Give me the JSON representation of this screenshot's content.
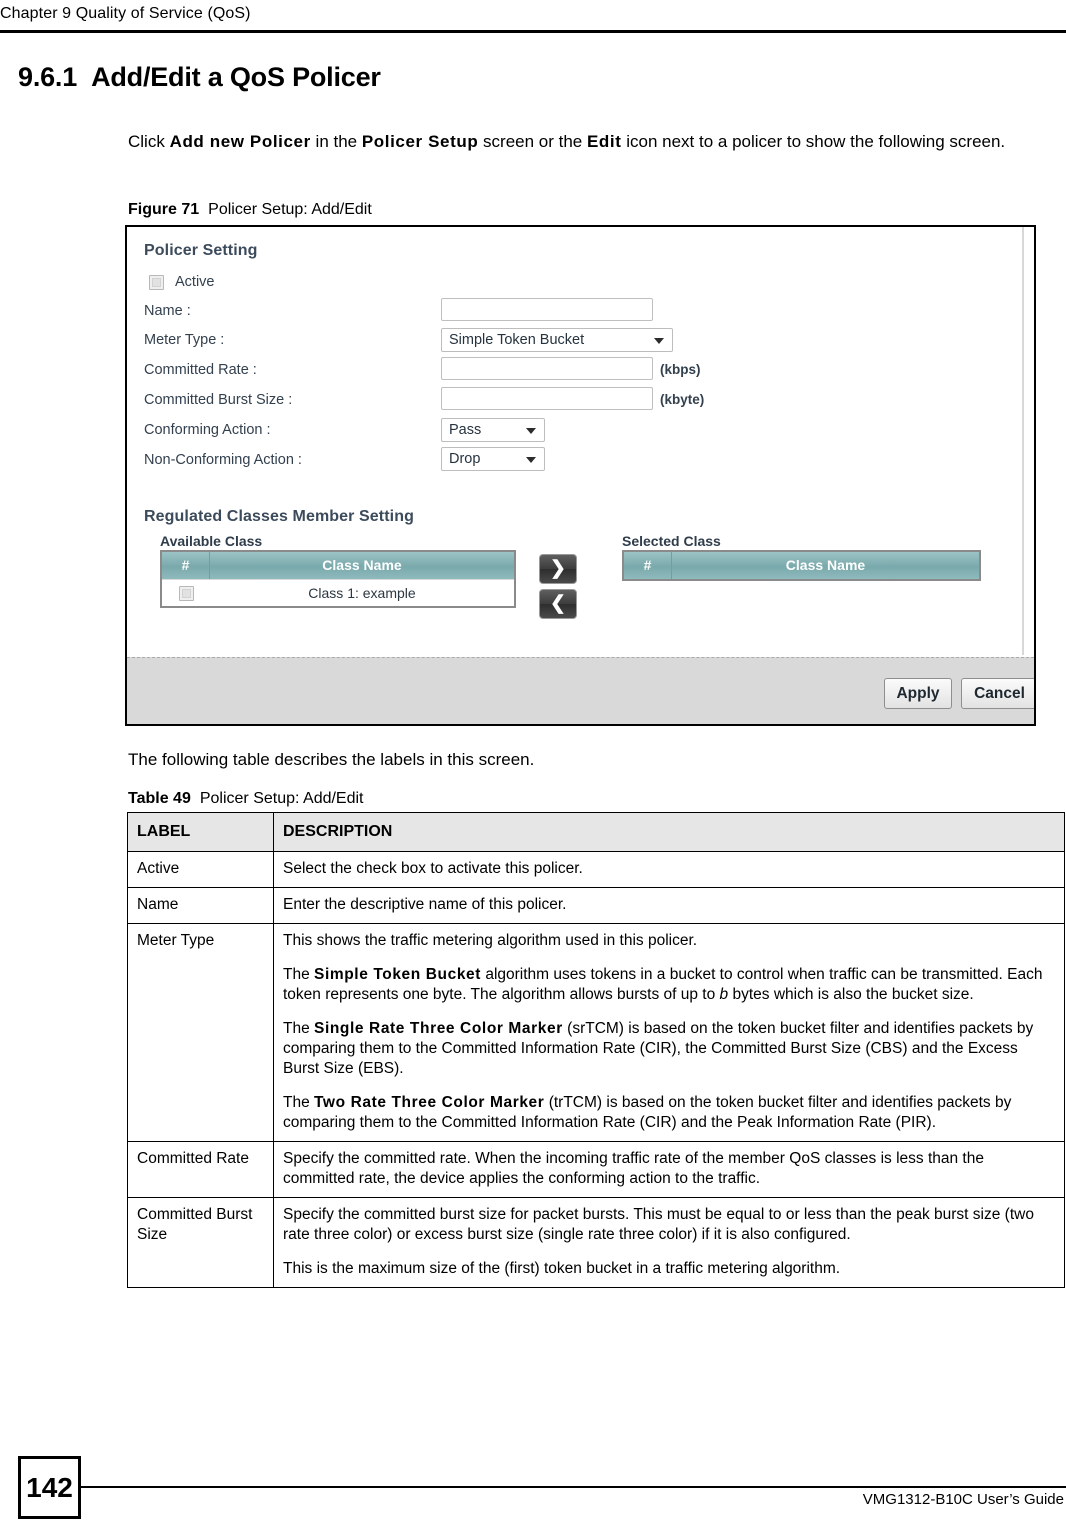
{
  "header": {
    "running_head": "Chapter 9 Quality of Service (QoS)"
  },
  "section": {
    "number": "9.6.1",
    "title": "Add/Edit a QoS Policer"
  },
  "intro": {
    "t1": "Click ",
    "b1": "Add new  Policer",
    "t2": " in the ",
    "b2": "Policer Setup",
    "t3": " screen or the ",
    "b3": "Edit",
    "t4": " icon next to a policer to show the following screen."
  },
  "figure": {
    "label": "Figure 71",
    "caption": "Policer Setup: Add/Edit"
  },
  "screen": {
    "policer_setting_title": "Policer Setting",
    "active_label": "Active",
    "name_label": "Name :",
    "meter_type_label": "Meter Type :",
    "meter_type_value": "Simple Token Bucket",
    "committed_rate_label": "Committed Rate :",
    "committed_rate_unit": "(kbps)",
    "committed_burst_label": "Committed Burst Size :",
    "committed_burst_unit": "(kbyte)",
    "conforming_label": "Conforming Action :",
    "conforming_value": "Pass",
    "nonconforming_label": "Non-Conforming Action :",
    "nonconforming_value": "Drop",
    "name_value": "",
    "committed_rate_value": "",
    "committed_burst_value": "",
    "regulated_title": "Regulated Classes Member Setting",
    "available_class_title": "Available Class",
    "selected_class_title": "Selected Class",
    "col_hash": "#",
    "col_class_name": "Class Name",
    "available_rows": [
      {
        "name": "Class 1: example"
      }
    ],
    "selected_rows": [],
    "move_right_icon": "❯",
    "move_left_icon": "❮",
    "apply_label": "Apply",
    "cancel_label": "Cancel"
  },
  "after_figure_text": "The following table describes the labels in this screen.",
  "table": {
    "caption_label": "Table 49",
    "caption_text": "Policer Setup: Add/Edit",
    "columns": [
      "LABEL",
      "DESCRIPTION"
    ],
    "rows": [
      {
        "label": "Active",
        "paragraphs": [
          {
            "parts": [
              {
                "text": "Select the check box to activate this policer."
              }
            ]
          }
        ]
      },
      {
        "label": "Name",
        "paragraphs": [
          {
            "parts": [
              {
                "text": "Enter the descriptive name of this policer."
              }
            ]
          }
        ]
      },
      {
        "label": "Meter Type",
        "paragraphs": [
          {
            "parts": [
              {
                "text": "This shows the traffic metering algorithm used in this policer."
              }
            ]
          },
          {
            "parts": [
              {
                "text": "The "
              },
              {
                "text": "Simple Token Bucket",
                "style": "bold"
              },
              {
                "text": " algorithm uses tokens in a bucket to control when traffic can be transmitted. Each token represents one byte. The algorithm allows bursts of up to "
              },
              {
                "text": "b",
                "style": "italic"
              },
              {
                "text": " bytes which is also the bucket size."
              }
            ]
          },
          {
            "parts": [
              {
                "text": "The "
              },
              {
                "text": "Single Rate Three Color Marker",
                "style": "bold"
              },
              {
                "text": " (srTCM) is based on the token bucket filter and identifies packets by comparing them to the Committed Information Rate (CIR), the Committed Burst Size (CBS) and the Excess Burst Size (EBS)."
              }
            ]
          },
          {
            "parts": [
              {
                "text": "The "
              },
              {
                "text": "Two Rate Three Color Marker",
                "style": "bold"
              },
              {
                "text": " (trTCM) is based on the token bucket filter and identifies packets by comparing them to the Committed Information Rate (CIR) and the Peak Information Rate (PIR)."
              }
            ]
          }
        ]
      },
      {
        "label": "Committed Rate",
        "paragraphs": [
          {
            "parts": [
              {
                "text": "Specify the committed rate. When the incoming traffic rate of the member QoS classes is less than the committed rate, the device applies the conforming action to the traffic."
              }
            ]
          }
        ]
      },
      {
        "label": "Committed Burst Size",
        "paragraphs": [
          {
            "parts": [
              {
                "text": "Specify the committed burst size for packet bursts. This must be equal to or less than the peak burst size (two rate three color) or excess burst size (single rate three color) if it is also configured."
              }
            ]
          },
          {
            "parts": [
              {
                "text": "This is the maximum size of the (first) token bucket in a traffic metering algorithm."
              }
            ]
          }
        ]
      }
    ]
  },
  "footer": {
    "page_number": "142",
    "guide_title": "VMG1312-B10C User’s Guide"
  },
  "colors": {
    "teal_header": "#79a9ac",
    "panel_footer_gray": "#d9d9d9",
    "table_header_gray": "#e6e6e6"
  }
}
